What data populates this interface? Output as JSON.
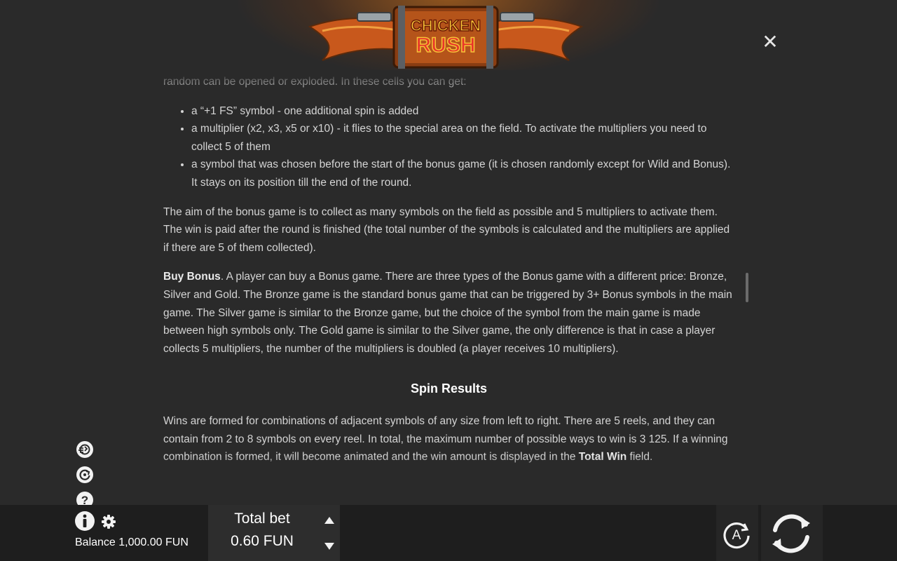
{
  "logo": {
    "line1": "CHICKEN",
    "line2": "RUSH"
  },
  "close": {
    "icon": "close-icon",
    "glyph": "✕"
  },
  "content": {
    "intro_partial": "random can be opened or exploded. In these cells you can get:",
    "bullets": [
      "a “+1 FS” symbol - one additional spin is added",
      "a multiplier (x2, x3, x5 or x10) - it flies to the special area on the field. To activate the multipliers you need to collect 5 of them",
      "a symbol that was chosen before the start of the bonus game (it is chosen randomly except for Wild and Bonus). It stays on its position till the end of the round."
    ],
    "aim_paragraph": "The aim of the bonus game is to collect as many symbols on the field as possible and 5 multipliers to activate them. The win is paid after the round is finished (the total number of the symbols is calculated and the multipliers are applied if there are 5 of them collected).",
    "buy_bonus_title": "Buy Bonus",
    "buy_bonus_text": ". A player can buy a Bonus game. There are three types of the Bonus game with a different price: Bronze, Silver and Gold. The Bronze game is the standard bonus game that can be triggered by 3+ Bonus symbols in the main game. The Silver game is similar to the Bronze game, but the choice of the symbol from the main game is made between high symbols only. The Gold game is similar to the Silver game, the only difference is that in case a player collects 5 multipliers, the number of the multipliers is doubled (a player receives 10 multipliers).",
    "spin_results_title": "Spin Results",
    "spin_results_text": "Wins are formed for combinations of adjacent symbols of any size from left to right. There are 5 reels, and they can contain from 2 to 8 symbols on every reel. In total, the maximum number of possible ways to win is 3 125. If a winning combination is formed, it will become animated and the win amount is displayed in the ",
    "total_win_bold": "Total Win",
    "spin_results_tail": " field."
  },
  "side_icons": [
    "turbo-spin-icon",
    "quick-spin-icon",
    "help-icon"
  ],
  "footer": {
    "info_icon": "info-icon",
    "settings_icon": "gear-icon",
    "balance": "Balance 1,000.00 FUN",
    "total_bet_label": "Total bet",
    "total_bet_value": "0.60 FUN",
    "autoplay_label": "A",
    "colors": {
      "panel": "#2d2d2d",
      "bar": "#1e1e1e",
      "text": "#ffffff"
    }
  }
}
